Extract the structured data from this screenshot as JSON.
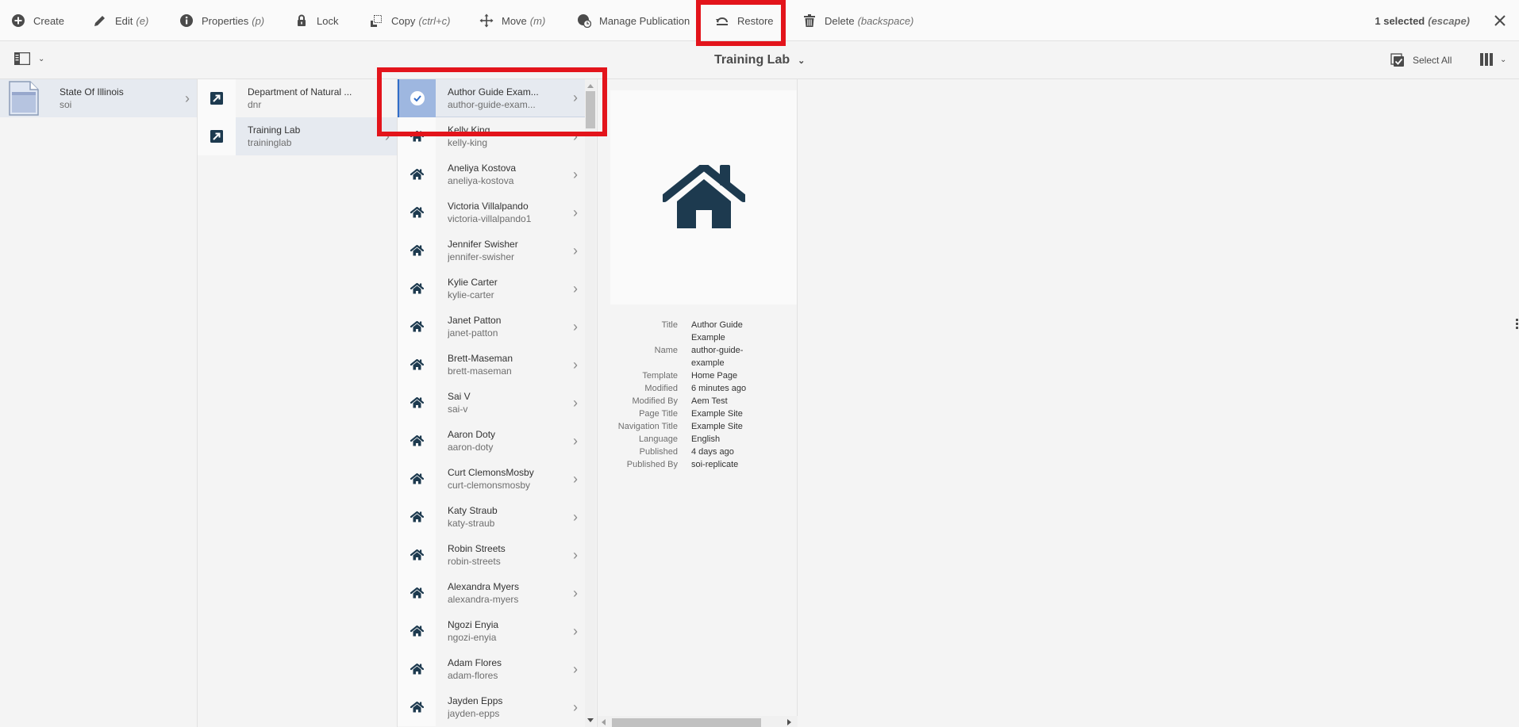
{
  "toolbar": {
    "actions": [
      {
        "label": "Create",
        "hint": "",
        "icon": "plus-circle-icon"
      },
      {
        "label": "Edit",
        "hint": "(e)",
        "icon": "pencil-icon"
      },
      {
        "label": "Properties",
        "hint": "(p)",
        "icon": "info-icon"
      },
      {
        "label": "Lock",
        "hint": "",
        "icon": "lock-icon"
      },
      {
        "label": "Copy",
        "hint": "(ctrl+c)",
        "icon": "copy-icon"
      },
      {
        "label": "Move",
        "hint": "(m)",
        "icon": "move-icon"
      },
      {
        "label": "Manage Publication",
        "hint": "",
        "icon": "globe-clock-icon"
      },
      {
        "label": "Restore",
        "hint": "",
        "icon": "undo-icon"
      },
      {
        "label": "Delete",
        "hint": "(backspace)",
        "icon": "trash-icon"
      }
    ],
    "selection": {
      "count_label": "1 selected",
      "hint": "(escape)"
    }
  },
  "header": {
    "title": "Training Lab",
    "select_all_label": "Select All"
  },
  "columns": {
    "col1": [
      {
        "title": "State Of Illinois",
        "name": "soi",
        "active": true
      }
    ],
    "col2": [
      {
        "title": "Department of Natural ...",
        "name": "dnr",
        "active": false
      },
      {
        "title": "Training Lab",
        "name": "traininglab",
        "active": true
      }
    ],
    "col3": [
      {
        "title": "Author Guide Exam...",
        "name": "author-guide-exam...",
        "selected": true
      },
      {
        "title": "Kelly King",
        "name": "kelly-king"
      },
      {
        "title": "Aneliya Kostova",
        "name": "aneliya-kostova"
      },
      {
        "title": "Victoria Villalpando",
        "name": "victoria-villalpando1"
      },
      {
        "title": "Jennifer Swisher",
        "name": "jennifer-swisher"
      },
      {
        "title": "Kylie Carter",
        "name": "kylie-carter"
      },
      {
        "title": "Janet Patton",
        "name": "janet-patton"
      },
      {
        "title": "Brett-Maseman",
        "name": "brett-maseman"
      },
      {
        "title": "Sai V",
        "name": "sai-v"
      },
      {
        "title": "Aaron Doty",
        "name": "aaron-doty"
      },
      {
        "title": "Curt ClemonsMosby",
        "name": "curt-clemonsmosby"
      },
      {
        "title": "Katy Straub",
        "name": "katy-straub"
      },
      {
        "title": "Robin Streets",
        "name": "robin-streets"
      },
      {
        "title": "Alexandra Myers",
        "name": "alexandra-myers"
      },
      {
        "title": "Ngozi Enyia",
        "name": "ngozi-enyia"
      },
      {
        "title": "Adam Flores",
        "name": "adam-flores"
      },
      {
        "title": "Jayden Epps",
        "name": "jayden-epps"
      }
    ]
  },
  "preview": {
    "meta": [
      {
        "key": "Title",
        "value": "Author Guide Example"
      },
      {
        "key": "Name",
        "value": "author-guide-example"
      },
      {
        "key": "Template",
        "value": "Home Page"
      },
      {
        "key": "Modified",
        "value": "6 minutes ago"
      },
      {
        "key": "Modified By",
        "value": "Aem Test"
      },
      {
        "key": "Page Title",
        "value": "Example Site"
      },
      {
        "key": "Navigation Title",
        "value": "Example Site"
      },
      {
        "key": "Language",
        "value": "English"
      },
      {
        "key": "Published",
        "value": "4 days ago"
      },
      {
        "key": "Published By",
        "value": "soi-replicate"
      }
    ]
  },
  "colors": {
    "highlight": "#e3141b",
    "icon_dark": "#1d3a4f",
    "selected_bg": "#9eb7e0",
    "active_row_bg": "#e6eaf0"
  }
}
